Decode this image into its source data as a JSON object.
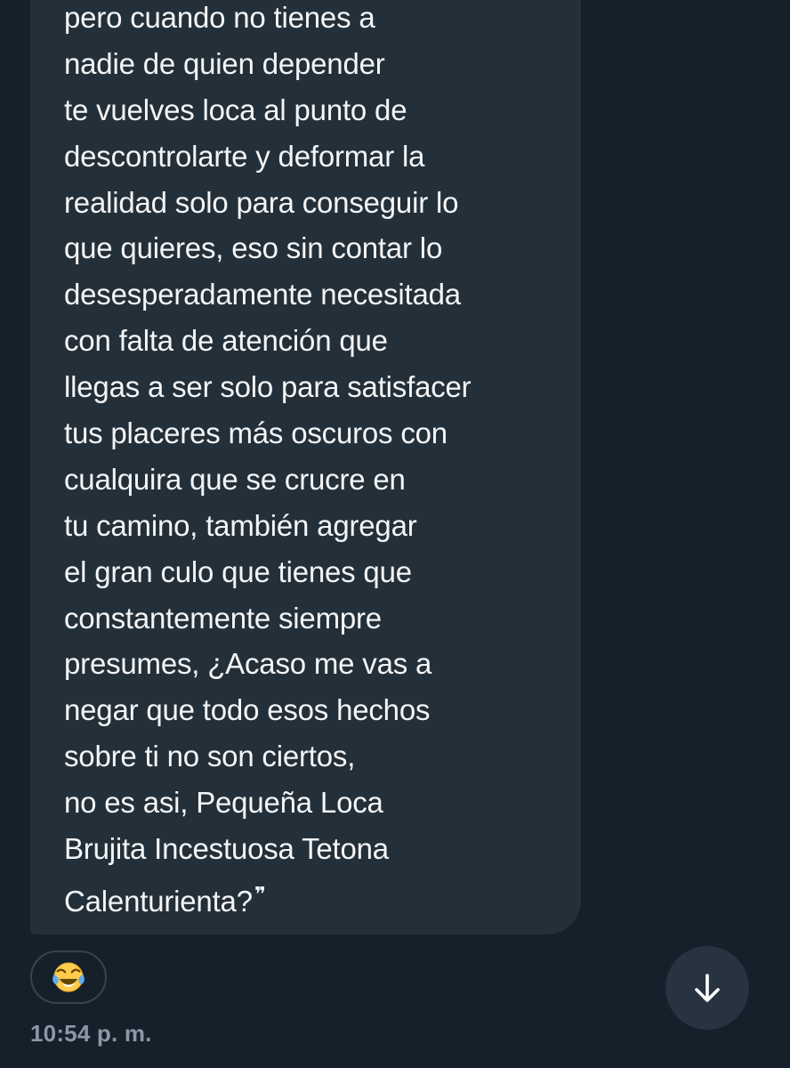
{
  "message": {
    "lines": [
      "pero cuando no tienes a",
      "nadie de quien depender",
      "te vuelves loca al punto de",
      "descontrolarte y deformar la",
      "realidad solo para conseguir lo",
      "que quieres, eso sin contar lo",
      "desesperadamente necesitada",
      "con falta de atención que",
      "llegas a ser solo para satisfacer",
      "tus placeres más oscuros con",
      "cualquira que se crucre en",
      "tu camino, también agregar",
      "el gran culo que tienes que",
      "constantemente siempre",
      "presumes, ¿Acaso me vas a",
      "negar que todo esos hechos",
      "sobre ti no son ciertos,",
      "no es asi, Pequeña Loca",
      "Brujita Incestuosa Tetona",
      "Calenturienta?"
    ],
    "closing_quote": "❞",
    "reaction": "😂",
    "reaction_icon": "face-with-tears-of-joy-icon",
    "timestamp": "10:54 p. m."
  },
  "controls": {
    "scroll_icon": "arrow-down-icon"
  },
  "colors": {
    "background": "#15202b",
    "bubble": "#243039",
    "text": "#f3f5f7",
    "muted_text": "#8b98a5",
    "pill_border": "#38444d",
    "scroll_button": "#273340"
  }
}
